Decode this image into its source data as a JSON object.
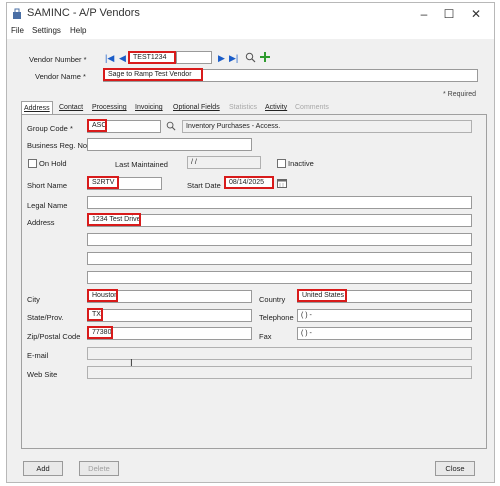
{
  "window": {
    "title": "SAMINC - A/P Vendors",
    "controls": {
      "minimize": "–",
      "maximize": "☐",
      "close": "✕"
    }
  },
  "menu": [
    "File",
    "Settings",
    "Help"
  ],
  "header": {
    "vendor_number_label": "Vendor Number *",
    "vendor_number": "TEST1234",
    "vendor_name_label": "Vendor Name *",
    "vendor_name": "Sage to Ramp Test Vendor",
    "required_note": "* Required"
  },
  "tabs": [
    {
      "label": "Address",
      "state": "active"
    },
    {
      "label": "Contact",
      "state": "normal"
    },
    {
      "label": "Processing",
      "state": "normal"
    },
    {
      "label": "Invoicing",
      "state": "normal"
    },
    {
      "label": "Optional Fields",
      "state": "normal"
    },
    {
      "label": "Statistics",
      "state": "disabled"
    },
    {
      "label": "Activity",
      "state": "normal"
    },
    {
      "label": "Comments",
      "state": "disabled"
    }
  ],
  "form": {
    "group_code_label": "Group Code *",
    "group_code": "ASC",
    "group_code_desc": "Inventory Purchases - Access.",
    "business_reg_label": "Business Reg. No.",
    "business_reg": "",
    "on_hold_label": "On Hold",
    "last_maintained_label": "Last Maintained",
    "last_maintained": "/ /",
    "inactive_label": "Inactive",
    "short_name_label": "Short Name",
    "short_name": "S2RTV",
    "start_date_label": "Start Date",
    "start_date": "08/14/2025",
    "legal_name_label": "Legal Name",
    "legal_name": "",
    "address_label": "Address",
    "address": [
      "1234 Test Drive",
      "",
      "",
      ""
    ],
    "city_label": "City",
    "city": "Houston",
    "country_label": "Country",
    "country": "United States",
    "state_label": "State/Prov.",
    "state": "TX",
    "telephone_label": "Telephone",
    "telephone": "( ) -",
    "zip_label": "Zip/Postal Code",
    "zip": "77380",
    "fax_label": "Fax",
    "fax": "( ) -",
    "email_label": "E-mail",
    "email": "",
    "website_label": "Web Site",
    "website": ""
  },
  "footer": {
    "add": "Add",
    "delete": "Delete",
    "close": "Close"
  },
  "colors": {
    "highlight": "#d81b1b",
    "nav_blue": "#1a5cc8",
    "add_green": "#2e9b2e"
  },
  "icons": [
    "app-icon",
    "first-record-icon",
    "previous-record-icon",
    "next-record-icon",
    "last-record-icon",
    "finder-icon",
    "new-record-icon",
    "calendar-icon",
    "text-cursor-icon"
  ]
}
